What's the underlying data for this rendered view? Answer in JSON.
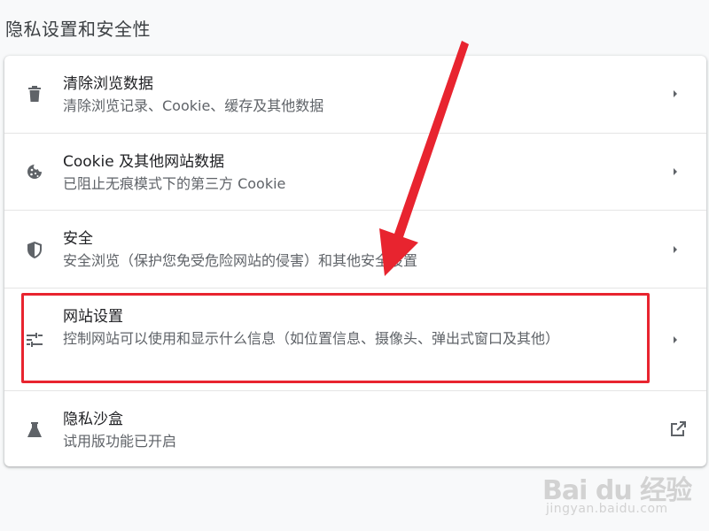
{
  "section": {
    "title": "隐私设置和安全性"
  },
  "rows": [
    {
      "title": "清除浏览数据",
      "subtitle": "清除浏览记录、Cookie、缓存及其他数据",
      "icon": "trash-icon"
    },
    {
      "title": "Cookie 及其他网站数据",
      "subtitle": "已阻止无痕模式下的第三方 Cookie",
      "icon": "cookie-icon"
    },
    {
      "title": "安全",
      "subtitle": "安全浏览（保护您免受危险网站的侵害）和其他安全设置",
      "icon": "shield-icon"
    },
    {
      "title": "网站设置",
      "subtitle": "控制网站可以使用和显示什么信息（如位置信息、摄像头、弹出式窗口及其他）",
      "icon": "tune-icon"
    },
    {
      "title": "隐私沙盒",
      "subtitle": "试用版功能已开启",
      "icon": "flask-icon"
    }
  ],
  "annotation": {
    "color": "#e8242f"
  },
  "watermark": {
    "brand": "Bai du 经验",
    "site": "jingyan.baidu.com"
  }
}
